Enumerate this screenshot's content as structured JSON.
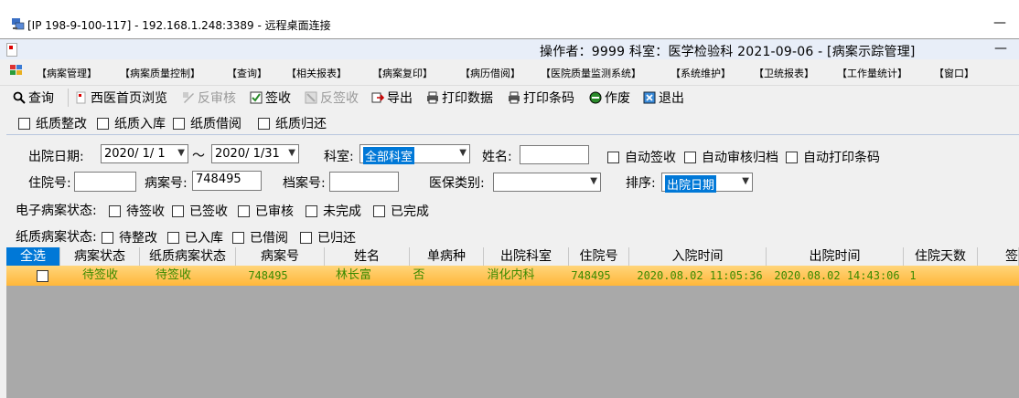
{
  "remote_title": "[IP 198-9-100-117] - 192.168.1.248:3389 - 远程桌面连接",
  "app_info": "操作者：9999  科室：医学检验科  2021-09-06 - [病案示踪管理]",
  "menu": [
    "【病案管理】",
    "【病案质量控制】",
    "【查询】",
    "【相关报表】",
    "【病案复印】",
    "【病历借阅】",
    "【医院质量监测系统】",
    "【系统维护】",
    "【卫统报表】",
    "【工作量统计】",
    "【窗口】"
  ],
  "toolbar": {
    "query": "查询",
    "browse": "西医首页浏览",
    "unreview": "反审核",
    "sign": "签收",
    "unsign": "反签收",
    "export": "导出",
    "print_data": "打印数据",
    "print_barcode": "打印条码",
    "void": "作废",
    "exit": "退出"
  },
  "paper_toggles": [
    "纸质整改",
    "纸质入库",
    "纸质借阅",
    "纸质归还"
  ],
  "search": {
    "discharge_date_label": "出院日期:",
    "date_from": "2020/ 1/ 1",
    "date_sep": "～",
    "date_to": "2020/ 1/31",
    "dept_label": "科室:",
    "dept_value": "全部科室",
    "name_label": "姓名:",
    "name_value": "",
    "auto_sign": "自动签收",
    "auto_review": "自动审核归档",
    "auto_print": "自动打印条码",
    "inpatient_label": "住院号:",
    "inpatient_value": "",
    "case_label": "病案号:",
    "case_value": "748495",
    "archive_label": "档案号:",
    "archive_value": "",
    "insurance_label": "医保类别:",
    "insurance_value": "",
    "sort_label": "排序:",
    "sort_value": "出院日期",
    "e_status_label": "电子病案状态:",
    "e_status": [
      "待签收",
      "已签收",
      "已审核",
      "未完成",
      "已完成"
    ],
    "p_status_label": "纸质病案状态:",
    "p_status": [
      "待整改",
      "已入库",
      "已借阅",
      "已归还"
    ]
  },
  "table": {
    "headers": [
      "全选",
      "病案状态",
      "纸质病案状态",
      "病案号",
      "姓名",
      "单病种",
      "出院科室",
      "住院号",
      "入院时间",
      "出院时间",
      "住院天数",
      "签"
    ],
    "rows": [
      [
        "",
        "待签收",
        "待签收",
        "748495",
        "林长富",
        "否",
        "消化内科",
        "748495",
        "2020.08.02 11:05:36",
        "2020.08.02 14:43:06",
        "1",
        ""
      ]
    ]
  }
}
